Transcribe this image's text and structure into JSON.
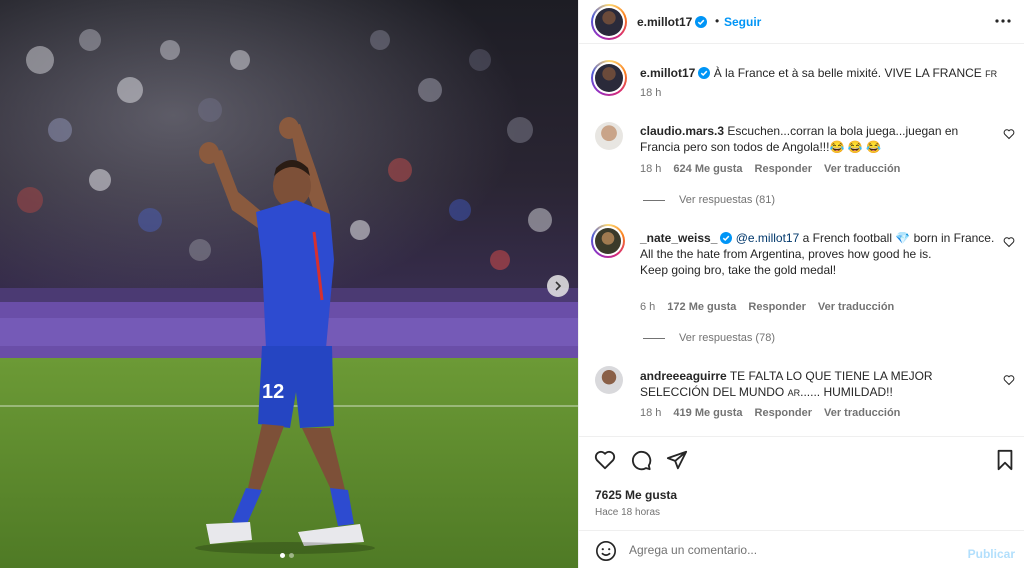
{
  "post": {
    "author": "e.millot17",
    "follow_label": "Seguir",
    "caption_text": "À la France et à sa belle mixité. VIVE LA FRANCE",
    "caption_flag": "FR",
    "caption_time": "18 h",
    "likes": "7625 Me gusta",
    "posted": "Hace 18 horas",
    "photo_jersey_number": "12"
  },
  "comments": [
    {
      "user": "claudio.mars.3",
      "text": "Escuchen...corran la bola juega...juegan en Francia pero son todos de Angola!!!😂 😂 😂",
      "time": "18 h",
      "likes": "624 Me gusta",
      "reply_label": "Responder",
      "translate_label": "Ver traducción",
      "view_replies": "Ver respuestas (81)"
    },
    {
      "user": "_nate_weiss_",
      "mention": "@e.millot17",
      "text_a": " a French football 💎 born in France.",
      "text_b": "All the the hate from Argentina, proves how good he is.",
      "text_c": "Keep going bro, take the gold medal!",
      "time": "6 h",
      "likes": "172 Me gusta",
      "reply_label": "Responder",
      "translate_label": "Ver traducción",
      "view_replies": "Ver respuestas (78)"
    },
    {
      "user": "andreeeaguirre",
      "text_a": "TE FALTA LO QUE TIENE LA MEJOR SELECCIÓN DEL MUNDO ",
      "flag": "AR",
      "text_b": "...... HUMILDAD!!",
      "time": "18 h",
      "likes": "419 Me gusta",
      "reply_label": "Responder",
      "translate_label": "Ver traducción"
    }
  ],
  "composer": {
    "placeholder": "Agrega un comentario...",
    "publish_label": "Publicar"
  },
  "icons": {
    "verified": "verified-badge-icon",
    "more": "more-options-icon",
    "like": "heart-icon",
    "comment": "comment-icon",
    "share": "share-icon",
    "save": "bookmark-icon",
    "emoji": "emoji-icon",
    "next": "chevron-right-icon"
  },
  "colors": {
    "accent": "#0095f6",
    "verified": "#0095f6",
    "kit_blue": "#2d4bd0",
    "pitch_green": "#5f8a2e"
  }
}
